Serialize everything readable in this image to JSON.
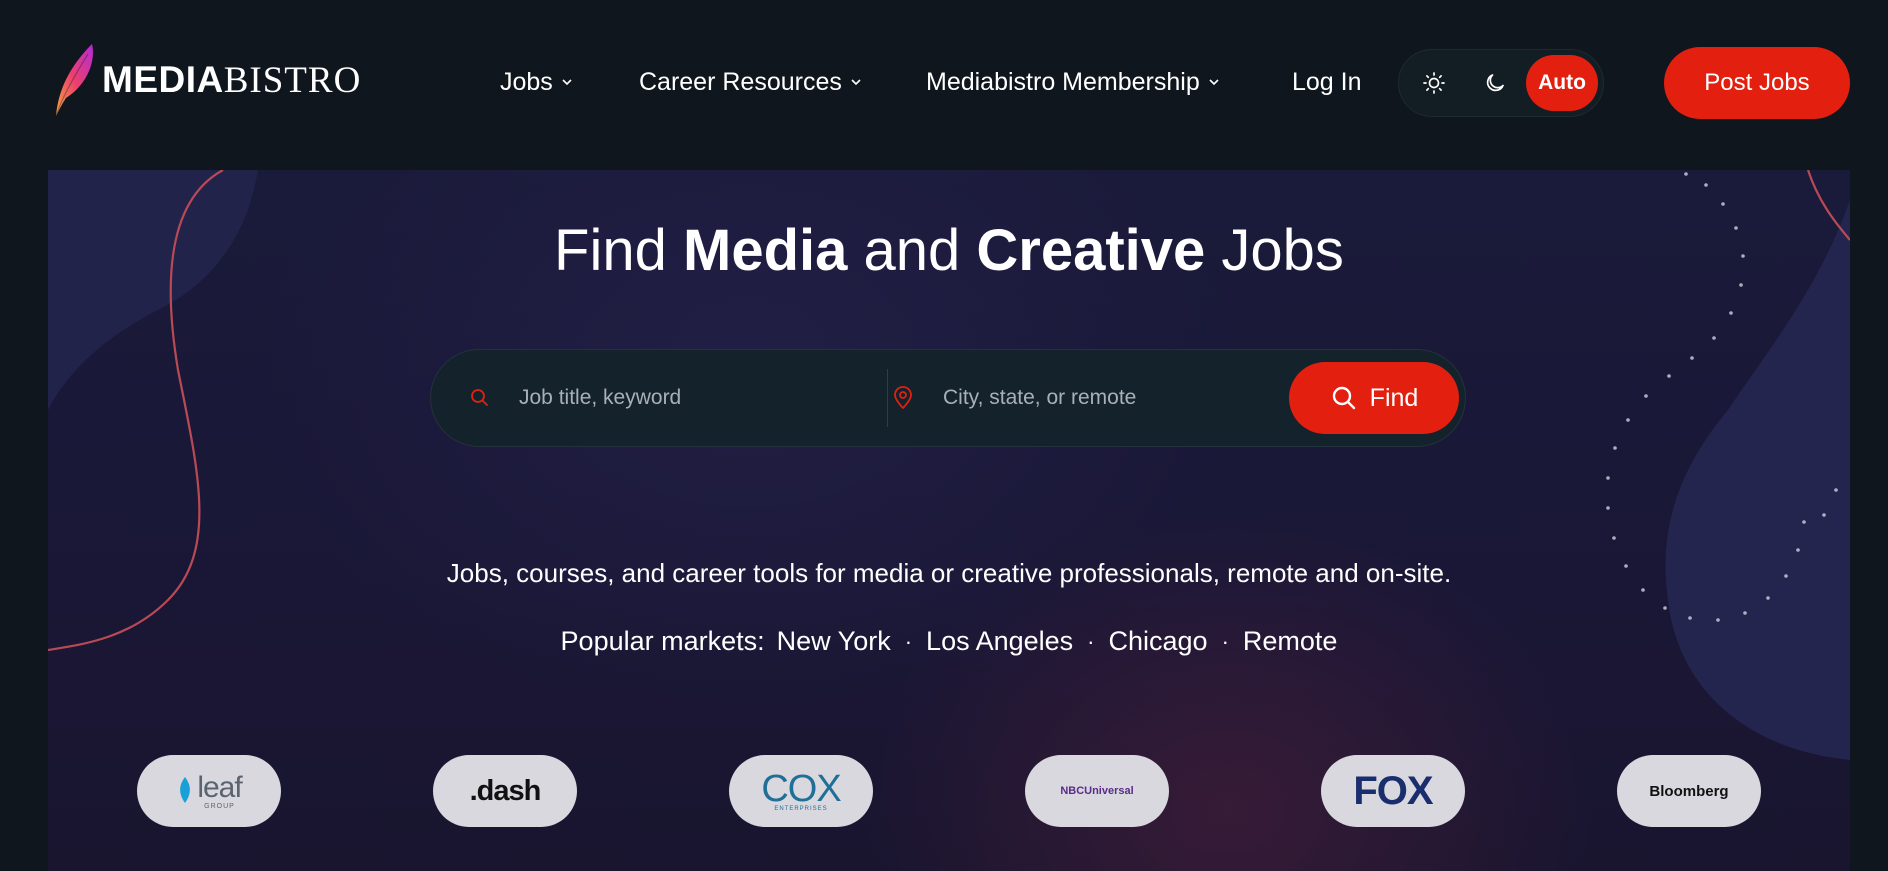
{
  "header": {
    "logo": {
      "bold": "MEDIA",
      "light": "BISTRO"
    },
    "nav": [
      {
        "label": "Jobs"
      },
      {
        "label": "Career Resources"
      },
      {
        "label": "Mediabistro Membership"
      }
    ],
    "login_label": "Log In",
    "theme": {
      "options": [
        "light",
        "dark",
        "Auto"
      ],
      "selected": "Auto",
      "auto_label": "Auto"
    },
    "post_jobs_label": "Post Jobs"
  },
  "hero": {
    "title": {
      "w1": "Find ",
      "b1": "Media",
      "w2": " and ",
      "b2": "Creative",
      "w3": " Jobs"
    },
    "search": {
      "keyword_placeholder": "Job title, keyword",
      "location_placeholder": "City, state, or remote",
      "find_label": "Find"
    },
    "tagline": "Jobs, courses, and career tools for media or creative professionals, remote and on-site.",
    "markets": {
      "label": "Popular markets:",
      "items": [
        "New York",
        "Los Angeles",
        "Chicago",
        "Remote"
      ]
    },
    "partner_logos": {
      "leaf": {
        "main": "leaf",
        "sub": "GROUP"
      },
      "dash": ".dash",
      "cox": {
        "main": "COX",
        "sub": "ENTERPRISES"
      },
      "nbc": "NBCUniversal",
      "fox": "FOX",
      "bloomberg": "Bloomberg"
    }
  },
  "colors": {
    "page_bg": "#0f161d",
    "accent": "#e3200f",
    "hero_bg": "#1a1a3a"
  }
}
